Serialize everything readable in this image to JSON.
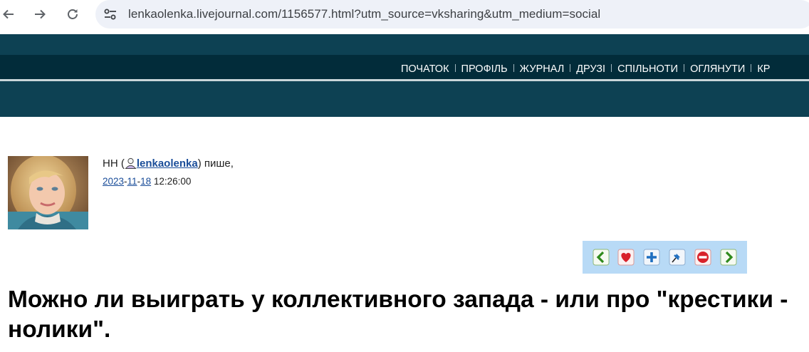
{
  "browser": {
    "url": "lenkaolenka.livejournal.com/1156577.html?utm_source=vksharing&utm_medium=social"
  },
  "navigation": {
    "items": [
      "ПОЧАТОК",
      "ПРОФІЛЬ",
      "ЖУРНАЛ",
      "ДРУЗІ",
      "СПІЛЬНОТИ",
      "ОГЛЯНУТИ",
      "КР"
    ]
  },
  "post": {
    "author_name": "НН (",
    "username": "lenkaolenka",
    "author_suffix": ") пише,",
    "date": {
      "year": "2023",
      "sep1": "-",
      "month": "11",
      "sep2": "-",
      "day": "18",
      "time": " 12:26:00"
    },
    "title": "Можно ли выиграть у коллективного запада - или про \"крестики - нолики\"."
  },
  "actions": {
    "icons": [
      "arrow-left-icon",
      "heart-icon",
      "plus-icon",
      "pin-icon",
      "stop-icon",
      "arrow-right-icon"
    ]
  },
  "colors": {
    "header_band": "#0d4153",
    "nav_bar": "#022c3a",
    "link": "#1a4d99",
    "toolbar_bg": "#b8daf6"
  }
}
